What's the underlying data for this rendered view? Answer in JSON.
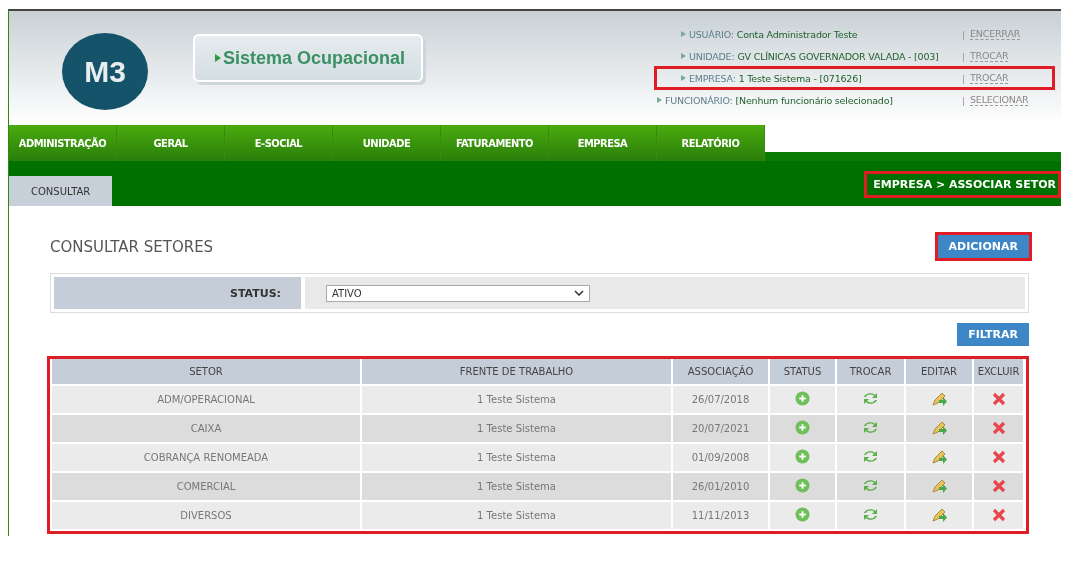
{
  "logo": {
    "text": "M3"
  },
  "product": {
    "title": "Sistema Ocupacional"
  },
  "session": [
    {
      "label": "USUÁRIO:",
      "value": "Conta Administrador Teste",
      "separator": "|",
      "action": "ENCERRAR",
      "highlighted": false
    },
    {
      "label": "UNIDADE:",
      "value": "GV CLÍNICAS GOVERNADOR VALADA - [003]",
      "separator": "|",
      "action": "TROCAR",
      "highlighted": false
    },
    {
      "label": "EMPRESA:",
      "value": "1 Teste Sistema - [071626]",
      "separator": "|",
      "action": "TROCAR",
      "highlighted": true
    },
    {
      "label": "FUNCIONÁRIO:",
      "value": "[Nenhum funcionário selecionado]",
      "separator": "|",
      "action": "SELECIONAR",
      "highlighted": false
    }
  ],
  "menu": [
    {
      "label": "ADMINISTRAÇÃO"
    },
    {
      "label": "GERAL"
    },
    {
      "label": "E-SOCIAL"
    },
    {
      "label": "UNIDADE"
    },
    {
      "label": "FATURAMENTO"
    },
    {
      "label": "EMPRESA"
    },
    {
      "label": "RELATÓRIO"
    }
  ],
  "subtabs": [
    {
      "label": "CONSULTAR",
      "selected": true
    }
  ],
  "breadcrumb": {
    "text": "EMPRESA > ASSOCIAR SETOR",
    "highlighted": true
  },
  "page_title": "CONSULTAR SETORES",
  "add_button": {
    "label": "ADICIONAR",
    "highlighted": true
  },
  "filter": {
    "label": "STATUS:",
    "value": "ATIVO"
  },
  "filter_button": {
    "label": "FILTRAR"
  },
  "table": {
    "highlighted": true,
    "columns": [
      "SETOR",
      "FRENTE DE TRABALHO",
      "ASSOCIAÇÃO",
      "STATUS",
      "TROCAR",
      "EDITAR",
      "EXCLUIR"
    ],
    "rows": [
      {
        "setor": "ADM/OPERACIONAL",
        "frente": "1 Teste Sistema",
        "associacao": "26/07/2018"
      },
      {
        "setor": "CAIXA",
        "frente": "1 Teste Sistema",
        "associacao": "20/07/2021"
      },
      {
        "setor": "COBRANÇA RENOMEADA",
        "frente": "1 Teste Sistema",
        "associacao": "01/09/2008"
      },
      {
        "setor": "COMERCIAL",
        "frente": "1 Teste Sistema",
        "associacao": "26/01/2010"
      },
      {
        "setor": "DIVERSOS",
        "frente": "1 Teste Sistema",
        "associacao": "11/11/2013"
      }
    ]
  }
}
